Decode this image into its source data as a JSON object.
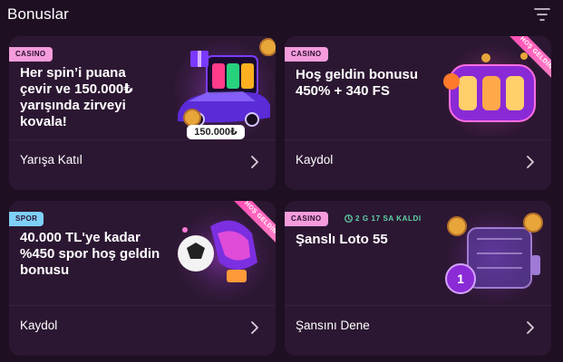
{
  "header": {
    "title": "Bonuslar",
    "filter_icon": "filter-icon"
  },
  "cards": [
    {
      "badge": "CASINO",
      "title": "Her spin’i puana\nçevir ve 150.000₺\nyarışında zirveyi\nkovala!",
      "cta": "Yarışa Katıl",
      "prize_tag": "150.000₺",
      "art": "car-and-slots"
    },
    {
      "badge": "CASINO",
      "title": "Hoş geldin bonusu\n450% + 340 FS",
      "cta": "Kaydol",
      "ribbon": "HOŞ GELDİN",
      "art": "slot-machine"
    },
    {
      "badge": "SPOR",
      "title": "40.000 TL'ye kadar\n%450 spor hoş geldin\nbonusu",
      "cta": "Kaydol",
      "ribbon": "HOŞ GELDİN",
      "art": "football-and-sneakers"
    },
    {
      "badge": "CASINO",
      "timer": "2 G 17 SA KALDI",
      "title": "Şanslı Loto 55",
      "cta": "Şansını Dene",
      "art": "lottery-drum"
    }
  ],
  "colors": {
    "background": "#1e0f22",
    "card": "#2c1732",
    "casino_badge": "#f59cdc",
    "spor_badge": "#7ed0f7",
    "timer": "#5fd4a8",
    "ribbon": "#ff4fb4"
  }
}
